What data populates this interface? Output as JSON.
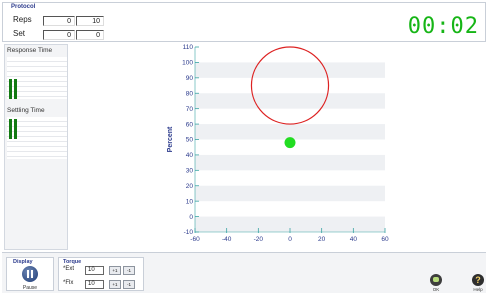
{
  "protocol": {
    "title": "Protocol",
    "reps_label": "Reps",
    "reps_done": "0",
    "reps_total": "10",
    "set_label": "Set",
    "set_done": "0",
    "set_total": "0"
  },
  "timer": "00:02",
  "left_panel": {
    "response_time_label": "Response Time",
    "settling_time_label": "Settling Time"
  },
  "chart_data": {
    "type": "scatter",
    "title": "",
    "xlabel": "",
    "ylabel": "Percent",
    "xlim": [
      -60,
      60
    ],
    "ylim": [
      -10,
      110
    ],
    "x_ticks": [
      -60,
      -40,
      -20,
      0,
      20,
      40,
      60
    ],
    "y_ticks": [
      -10,
      0,
      10,
      20,
      30,
      40,
      50,
      60,
      70,
      80,
      90,
      100,
      110
    ],
    "y_tick_labels": [
      "-10",
      "0",
      "10",
      "20",
      "30",
      "40",
      "50",
      "60",
      "70",
      "80",
      "90",
      "100",
      "110"
    ],
    "grid": "horizontal bands",
    "target": {
      "x": 0,
      "y": 85,
      "radius": 25,
      "color": "#dd2222"
    },
    "point": {
      "x": 0,
      "y": 48,
      "color": "#22dd22"
    }
  },
  "bottom": {
    "display_title": "Display",
    "pause_label": "Pause",
    "torque_title": "Torque",
    "ext_label": "*Ext",
    "ext_value": "10",
    "flx_label": "*Flx",
    "flx_value": "10",
    "step_up": "+1",
    "step_down": "-1",
    "ok_label": "OK",
    "help_label": "Help",
    "help_glyph": "?"
  },
  "colors": {
    "timer": "#16b516",
    "accent_blue": "#2b3a8c",
    "bar_green": "#127a12"
  }
}
